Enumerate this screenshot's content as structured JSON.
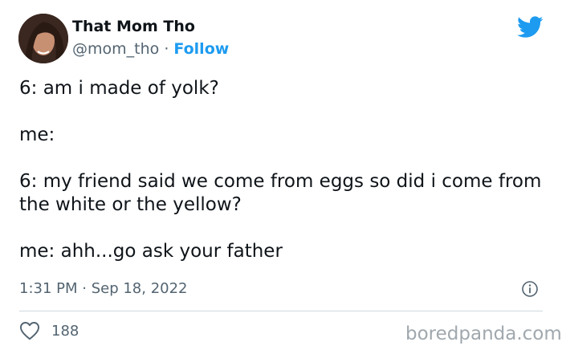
{
  "user": {
    "name": "That Mom Tho",
    "handle": "@mom_tho",
    "separator": "·",
    "follow_label": "Follow"
  },
  "tweet": {
    "paragraphs": [
      "6: am i made of yolk?",
      "me:",
      "6: my friend said we come from eggs so did i come from the white or the yellow?",
      "me: ahh...go ask your father"
    ],
    "timestamp": "1:31 PM · Sep 18, 2022"
  },
  "engagement": {
    "likes": "188"
  },
  "watermark": "boredpanda.com",
  "icons": {
    "brand": "twitter-bird-icon",
    "info": "info-icon",
    "like": "heart-icon"
  },
  "colors": {
    "accent": "#1d9bf0",
    "text": "#0f1419",
    "muted": "#536471",
    "divider": "#cfd9de"
  }
}
